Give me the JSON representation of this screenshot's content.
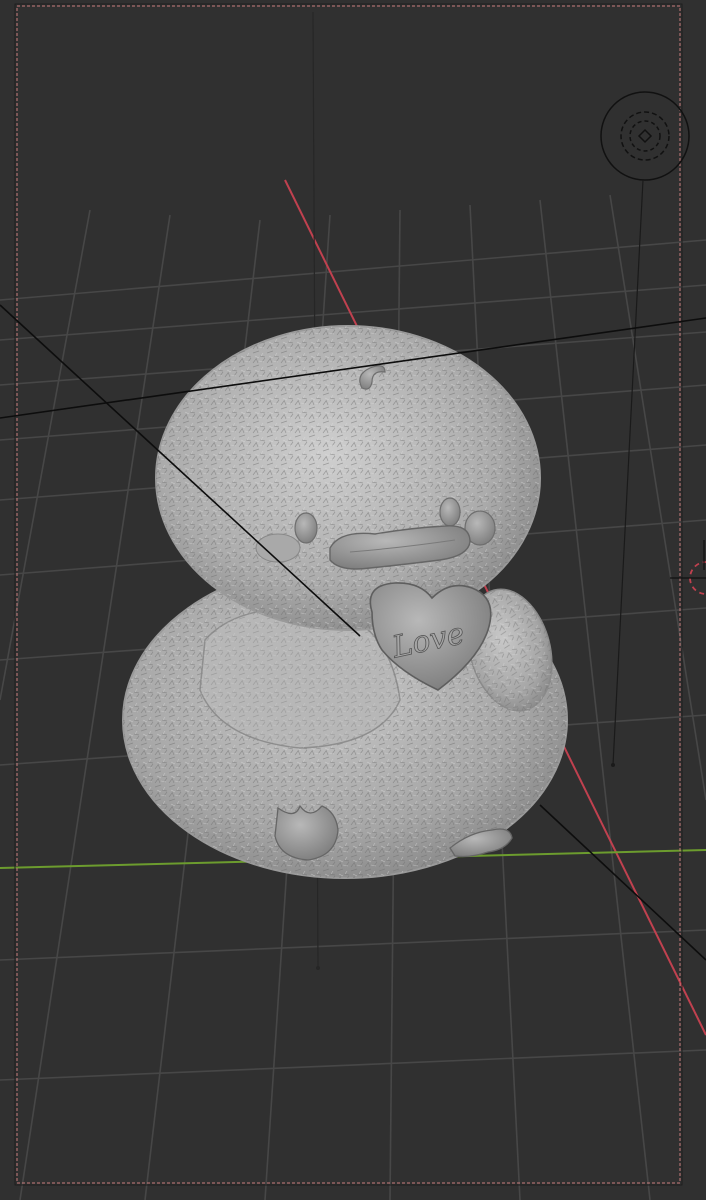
{
  "app": "3D viewport",
  "viewport": {
    "background": "#303030",
    "grid_color": "#474747",
    "axis_x_color": "#c0414f",
    "axis_y_color": "#6c9c2e",
    "camera_frame_color": "#c77d7d"
  },
  "model": {
    "name": "fluffy-duckling",
    "heart_text": "Love",
    "fur_color": "#bdbdbd",
    "solid_color": "#9a9a9a"
  },
  "icons": {
    "light": "light-icon",
    "cursor": "3d-cursor-icon"
  }
}
